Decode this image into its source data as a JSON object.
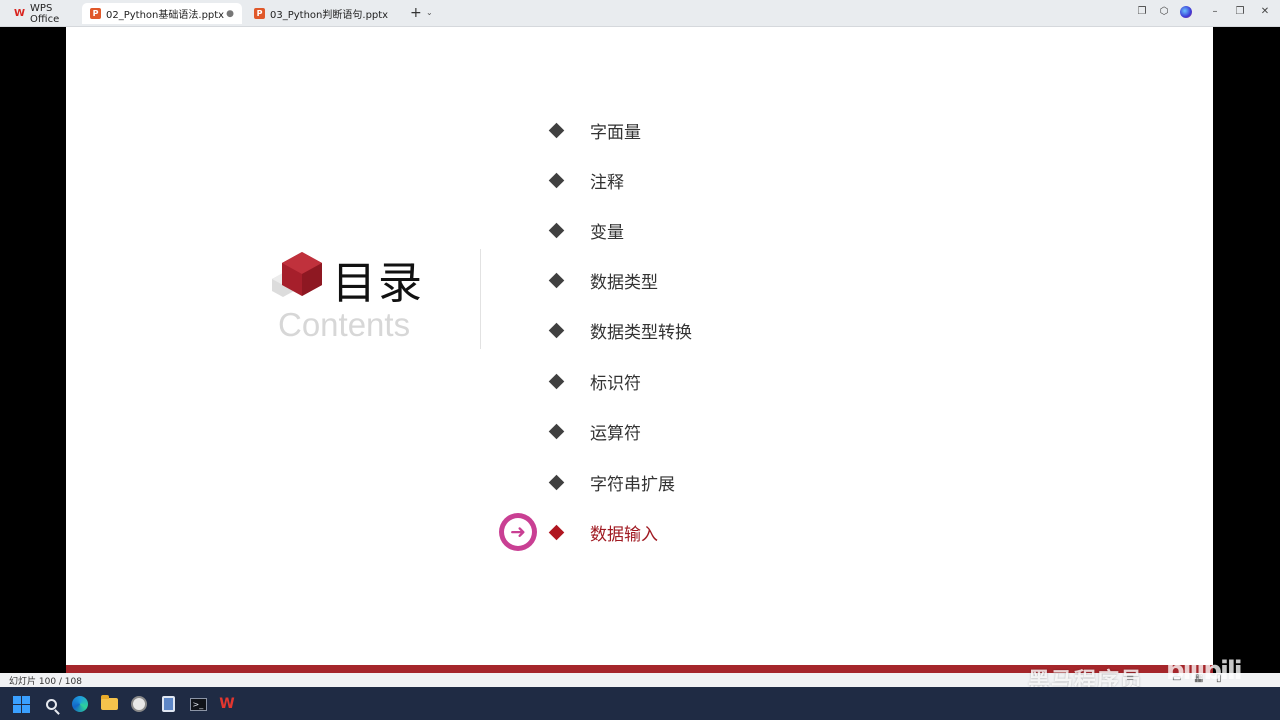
{
  "window": {
    "tabs": [
      {
        "label": "WPS Office",
        "icon": "wps-logo-icon"
      },
      {
        "label": "02_Python基础语法.pptx",
        "icon": "presentation-file-icon",
        "active": true
      },
      {
        "label": "03_Python判断语句.pptx",
        "icon": "presentation-file-icon"
      }
    ],
    "new_tab_symbol": "+",
    "new_tab_more_symbol": "⌄"
  },
  "slide": {
    "title": "目录",
    "subtitle": "Contents",
    "items": [
      "字面量",
      "注释",
      "变量",
      "数据类型",
      "数据类型转换",
      "标识符",
      "运算符",
      "字符串扩展",
      "数据输入"
    ],
    "current_item": "数据输入",
    "colors": {
      "accent_red": "#a5262b",
      "current_item": "#a01a22",
      "arrow_badge": "#c93f93",
      "bullet": "#404040"
    }
  },
  "statusbar": {
    "slide_counter": "幻灯片 100 / 108"
  },
  "watermark": {
    "text": "黑马程序员",
    "mark": "bilibili"
  },
  "taskbar": {
    "apps": [
      "start-icon",
      "search-icon",
      "edge-icon",
      "file-explorer-icon",
      "clock-icon",
      "calculator-icon",
      "terminal-icon",
      "wps-icon"
    ]
  }
}
